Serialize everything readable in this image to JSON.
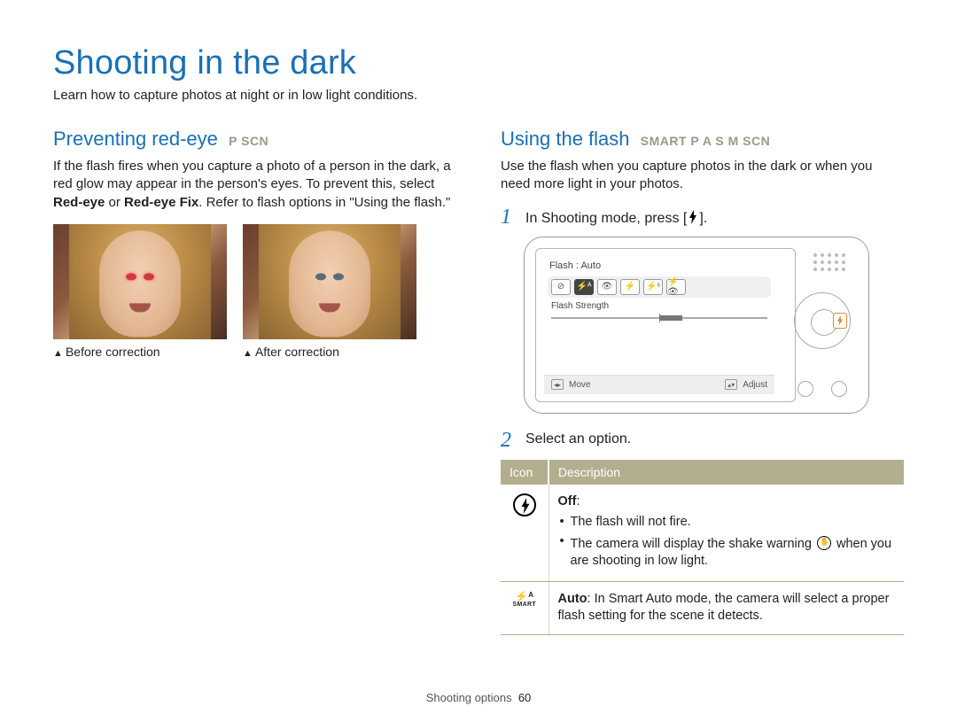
{
  "page": {
    "title": "Shooting in the dark",
    "subtitle": "Learn how to capture photos at night or in low light conditions."
  },
  "sections": {
    "redeye": {
      "heading": "Preventing red-eye",
      "modes": "P SCN",
      "body_pre": "If the flash fires when you capture a photo of a person in the dark, a red glow may appear in the person's eyes. To prevent this, select ",
      "body_bold1": "Red-eye",
      "body_mid": " or ",
      "body_bold2": "Red-eye Fix",
      "body_post": ". Refer to flash options in \"Using the flash.\"",
      "caption_before": "Before correction",
      "caption_after": "After correction"
    },
    "flash": {
      "heading": "Using the flash",
      "modes": "SMART P A S M SCN",
      "body": "Use the flash when you capture photos in the dark or when you need more light in your photos.",
      "step1": "In Shooting mode, press [",
      "step1_end": "].",
      "step2": "Select an option.",
      "lcd": {
        "title": "Flash : Auto",
        "strength_label": "Flash Strength",
        "move": "Move",
        "adjust": "Adjust"
      },
      "table": {
        "col_icon": "Icon",
        "col_desc": "Description",
        "rows": [
          {
            "icon": "flash-off",
            "title": "Off",
            "bullets": [
              "The flash will not fire.",
              "The camera will display the shake warning __HAND__ when you are shooting in low light."
            ]
          },
          {
            "icon": "auto-smart",
            "title": "Auto",
            "text": ": In Smart Auto mode, the camera will select a proper flash setting for the scene it detects."
          }
        ]
      }
    }
  },
  "footer": {
    "section": "Shooting options",
    "page": "60"
  }
}
